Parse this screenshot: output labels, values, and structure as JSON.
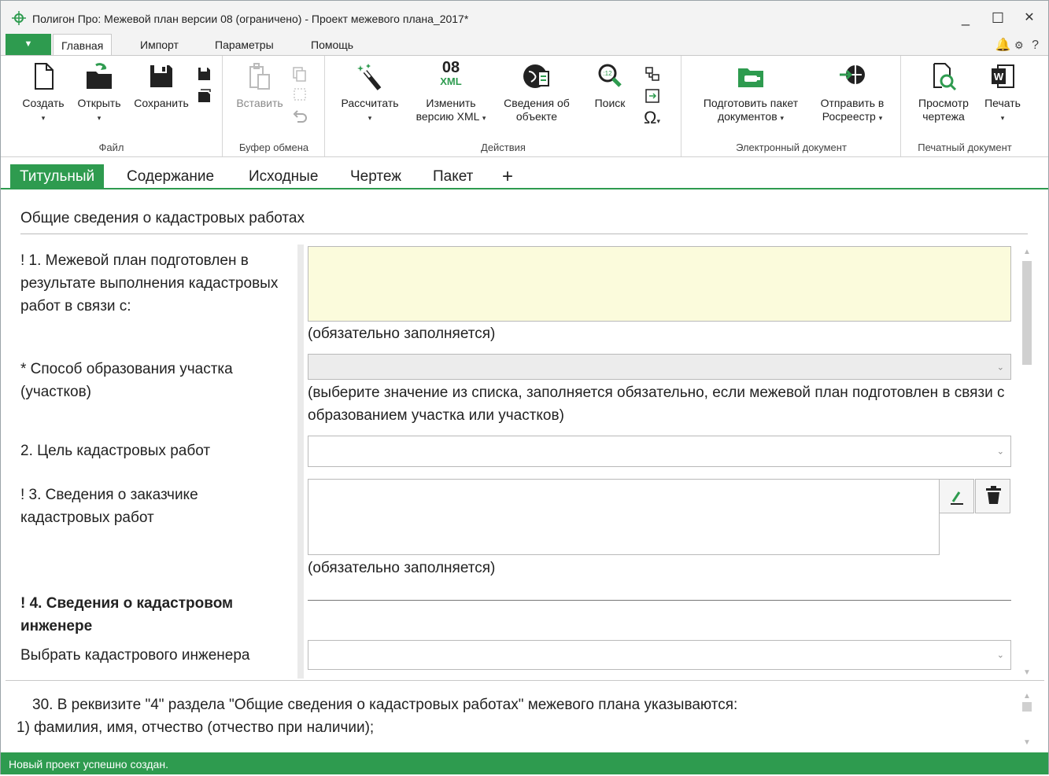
{
  "window": {
    "title": "Полигон Про: Межевой план версии 08 (ограничено) - Проект межевого плана_2017*",
    "minimize": "_",
    "maximize": "☐",
    "close": "✕"
  },
  "menu": {
    "app_menu": "▼",
    "tabs": [
      "Главная",
      "Импорт",
      "Параметры",
      "Помощь"
    ],
    "help_icon": "?"
  },
  "ribbon": {
    "groups": {
      "file": "Файл",
      "clipboard": "Буфер обмена",
      "actions": "Действия",
      "edoc": "Электронный документ",
      "print": "Печатный документ"
    },
    "buttons": {
      "create": "Создать",
      "open": "Открыть",
      "save": "Сохранить",
      "paste": "Вставить",
      "calculate": "Рассчитать",
      "change_xml_1": "Изменить",
      "change_xml_2": "версию XML",
      "xml_icon_top": "08",
      "xml_icon_bottom": "XML",
      "object_info_1": "Сведения об",
      "object_info_2": "объекте",
      "search": "Поиск",
      "prepare_1": "Подготовить пакет",
      "prepare_2": "документов",
      "send_1": "Отправить в",
      "send_2": "Росреестр",
      "preview_1": "Просмотр",
      "preview_2": "чертежа",
      "print": "Печать",
      "omega": "Ω"
    }
  },
  "page_tabs": [
    "Титульный",
    "Содержание",
    "Исходные",
    "Чертеж",
    "Пакет",
    "+"
  ],
  "form": {
    "section_title": "Общие сведения о кадастровых работах",
    "f1_label": "! 1. Межевой план подготовлен в результате выполнения кадастровых работ в связи с:",
    "f1_hint": "(обязательно заполняется)",
    "f1_value": "",
    "method_label": "* Способ образования участка (участков)",
    "method_value": "",
    "method_hint": "(выберите значение из списка, заполняется обязательно, если межевой план подготовлен в связи с образованием участка или участков)",
    "f2_label": "2. Цель кадастровых работ",
    "f2_value": "",
    "f3_label": "! 3. Сведения о заказчике кадастровых работ",
    "f3_value": "",
    "f3_hint": "(обязательно заполняется)",
    "f4_label": "! 4. Сведения о кадастровом инженере",
    "engineer_label": "Выбрать кадастрового инженера",
    "engineer_value": ""
  },
  "help": {
    "line1": "30. В реквизите \"4\" раздела \"Общие сведения о кадастровых работах\" межевого плана указываются:",
    "line2": "1) фамилия, имя, отчество (отчество при наличии);"
  },
  "status": {
    "text": "Новый проект успешно создан."
  },
  "colors": {
    "accent": "#2e9b4f",
    "required_field": "#fbfbdc"
  }
}
